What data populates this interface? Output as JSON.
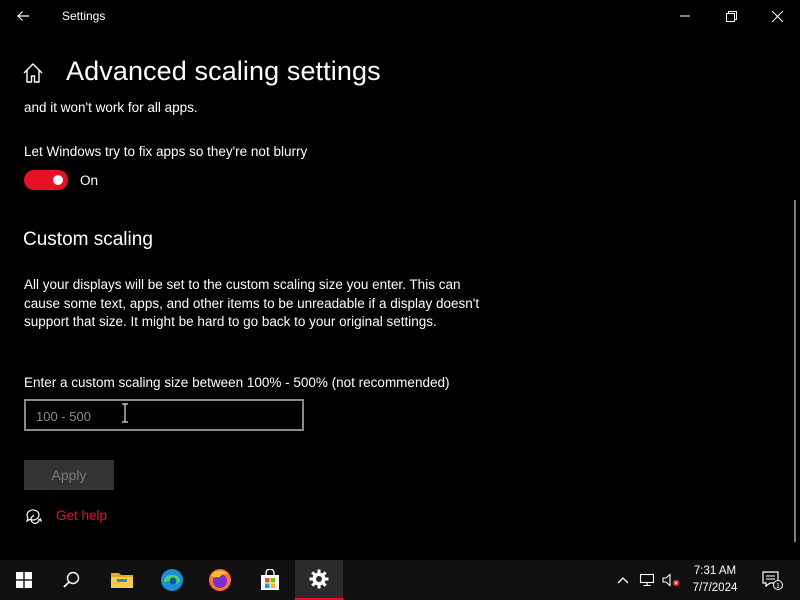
{
  "window": {
    "title": "Settings"
  },
  "header": {
    "title": "Advanced scaling settings"
  },
  "content": {
    "clipped_line": "and it won't work for all apps.",
    "fix_apps_label": "Let Windows try to fix apps so they're not blurry",
    "toggle_state": "On",
    "custom_scaling_title": "Custom scaling",
    "custom_scaling_desc": "All your displays will be set to the custom scaling size you enter. This can cause some text, apps, and other items to be unreadable if a display doesn't support that size. It might be hard to go back to your original settings.",
    "input_label": "Enter a custom scaling size between 100% - 500% (not recommended)",
    "input_placeholder": "100 - 500",
    "input_value": "",
    "apply_label": "Apply",
    "get_help_label": "Get help"
  },
  "taskbar": {
    "time": "7:31 AM",
    "date": "7/7/2024",
    "notification_count": "1",
    "apps": [
      "start-icon",
      "search-icon",
      "file-explorer-icon",
      "edge-icon",
      "firefox-icon",
      "store-icon",
      "settings-icon"
    ]
  },
  "colors": {
    "accent": "#e81123",
    "background": "#000000",
    "taskbar": "#101010"
  }
}
